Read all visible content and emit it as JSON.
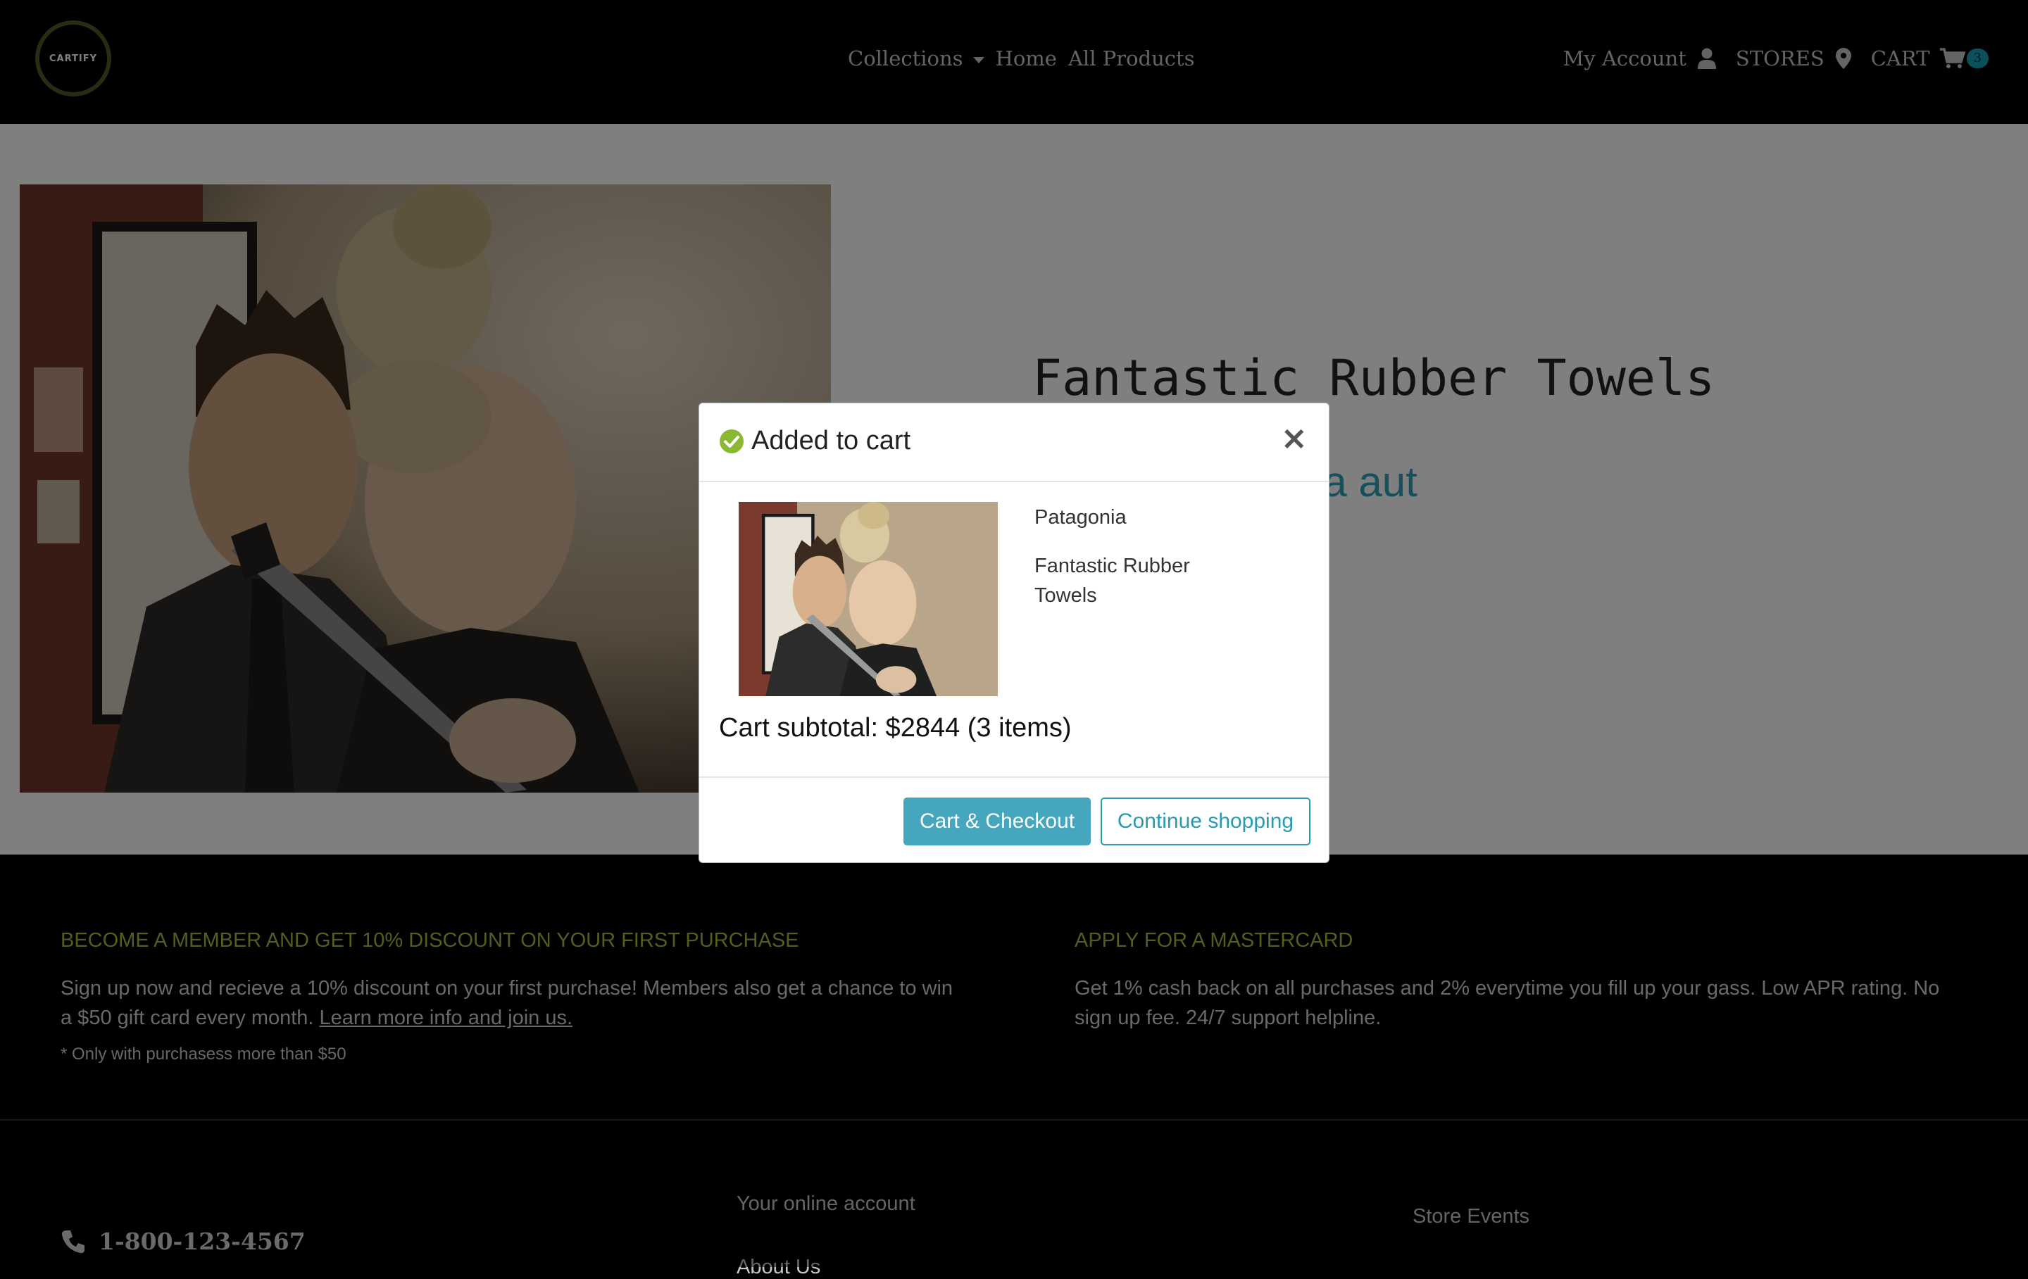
{
  "header": {
    "logo_text": "CARTIFY",
    "nav": {
      "collections": "Collections",
      "home": "Home",
      "all_products": "All Products"
    },
    "account": {
      "my_account": "My Account",
      "stores": "STORES",
      "cart": "CART",
      "cart_count": "3"
    }
  },
  "product": {
    "title": "Fantastic Rubber Towels",
    "subtitle_visible": "ea aut",
    "image_icon": "photo-couple-with-knife"
  },
  "modal": {
    "title": "Added to cart",
    "close": "×",
    "brand": "Patagonia",
    "product_name": "Fantastic Rubber Towels",
    "subtotal": "Cart subtotal: $2844 (3 items)",
    "checkout_button": "Cart & Checkout",
    "continue_button": "Continue shopping"
  },
  "promo": {
    "member": {
      "heading": "BECOME A MEMBER AND GET 10% DISCOUNT ON YOUR FIRST PURCHASE",
      "text": "Sign up now and recieve a 10% discount on your first purchase! Members also get a chance to win a $50 gift card every month.",
      "link": "Learn more info and join us.",
      "note": "* Only with purchasess more than $50"
    },
    "mastercard": {
      "heading": "APPLY FOR A MASTERCARD",
      "text": "Get 1% cash back on all purchases and 2% everytime you fill up your gass. Low APR rating. No sign up fee. 24/7 support helpline."
    }
  },
  "footer": {
    "phone": "1-800-123-4567",
    "online_account": "Your online account",
    "about_us": "About Us",
    "store_events": "Store Events"
  },
  "colors": {
    "accent": "#17a2b8",
    "promo_heading": "#a8bb3c",
    "logo_ring": "#4d5a25",
    "success": "#8ab833"
  }
}
